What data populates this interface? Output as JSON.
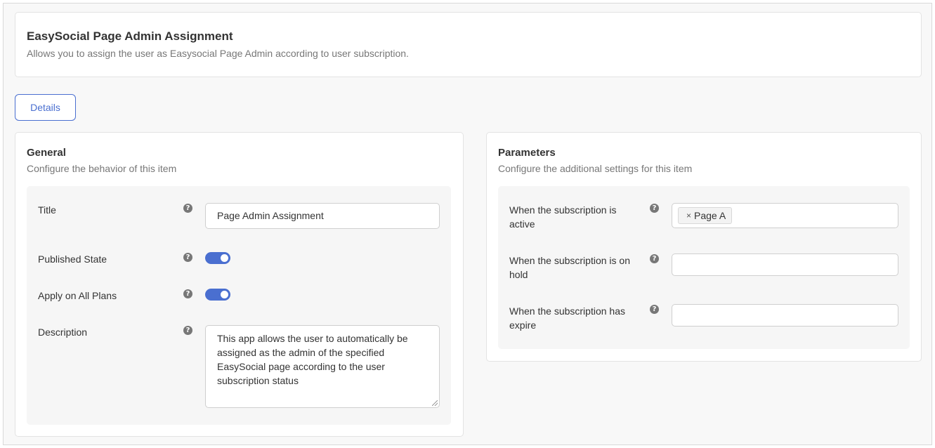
{
  "header": {
    "title": "EasySocial Page Admin Assignment",
    "subtitle": "Allows you to assign the user as Easysocial Page Admin according to user subscription."
  },
  "tabs": [
    {
      "label": "Details",
      "active": true
    }
  ],
  "general": {
    "title": "General",
    "description": "Configure the behavior of this item",
    "fields": {
      "title": {
        "label": "Title",
        "value": "Page Admin Assignment"
      },
      "published_state": {
        "label": "Published State",
        "enabled": true
      },
      "apply_all_plans": {
        "label": "Apply on All Plans",
        "enabled": true
      },
      "description": {
        "label": "Description",
        "value": "This app allows the user to automatically be assigned as the admin of the specified EasySocial page according to the user subscription status"
      }
    }
  },
  "parameters": {
    "title": "Parameters",
    "description": "Configure the additional settings for this item",
    "fields": {
      "active": {
        "label": "When the subscription is active",
        "tags": [
          "Page A"
        ]
      },
      "on_hold": {
        "label": "When the subscription is on hold",
        "tags": []
      },
      "expire": {
        "label": "When the subscription has expire",
        "tags": []
      }
    }
  },
  "icons": {
    "help": "question-circle-icon",
    "tag_remove": "close-icon"
  },
  "colors": {
    "accent": "#4a6fd0",
    "help_icon": "#777777"
  }
}
